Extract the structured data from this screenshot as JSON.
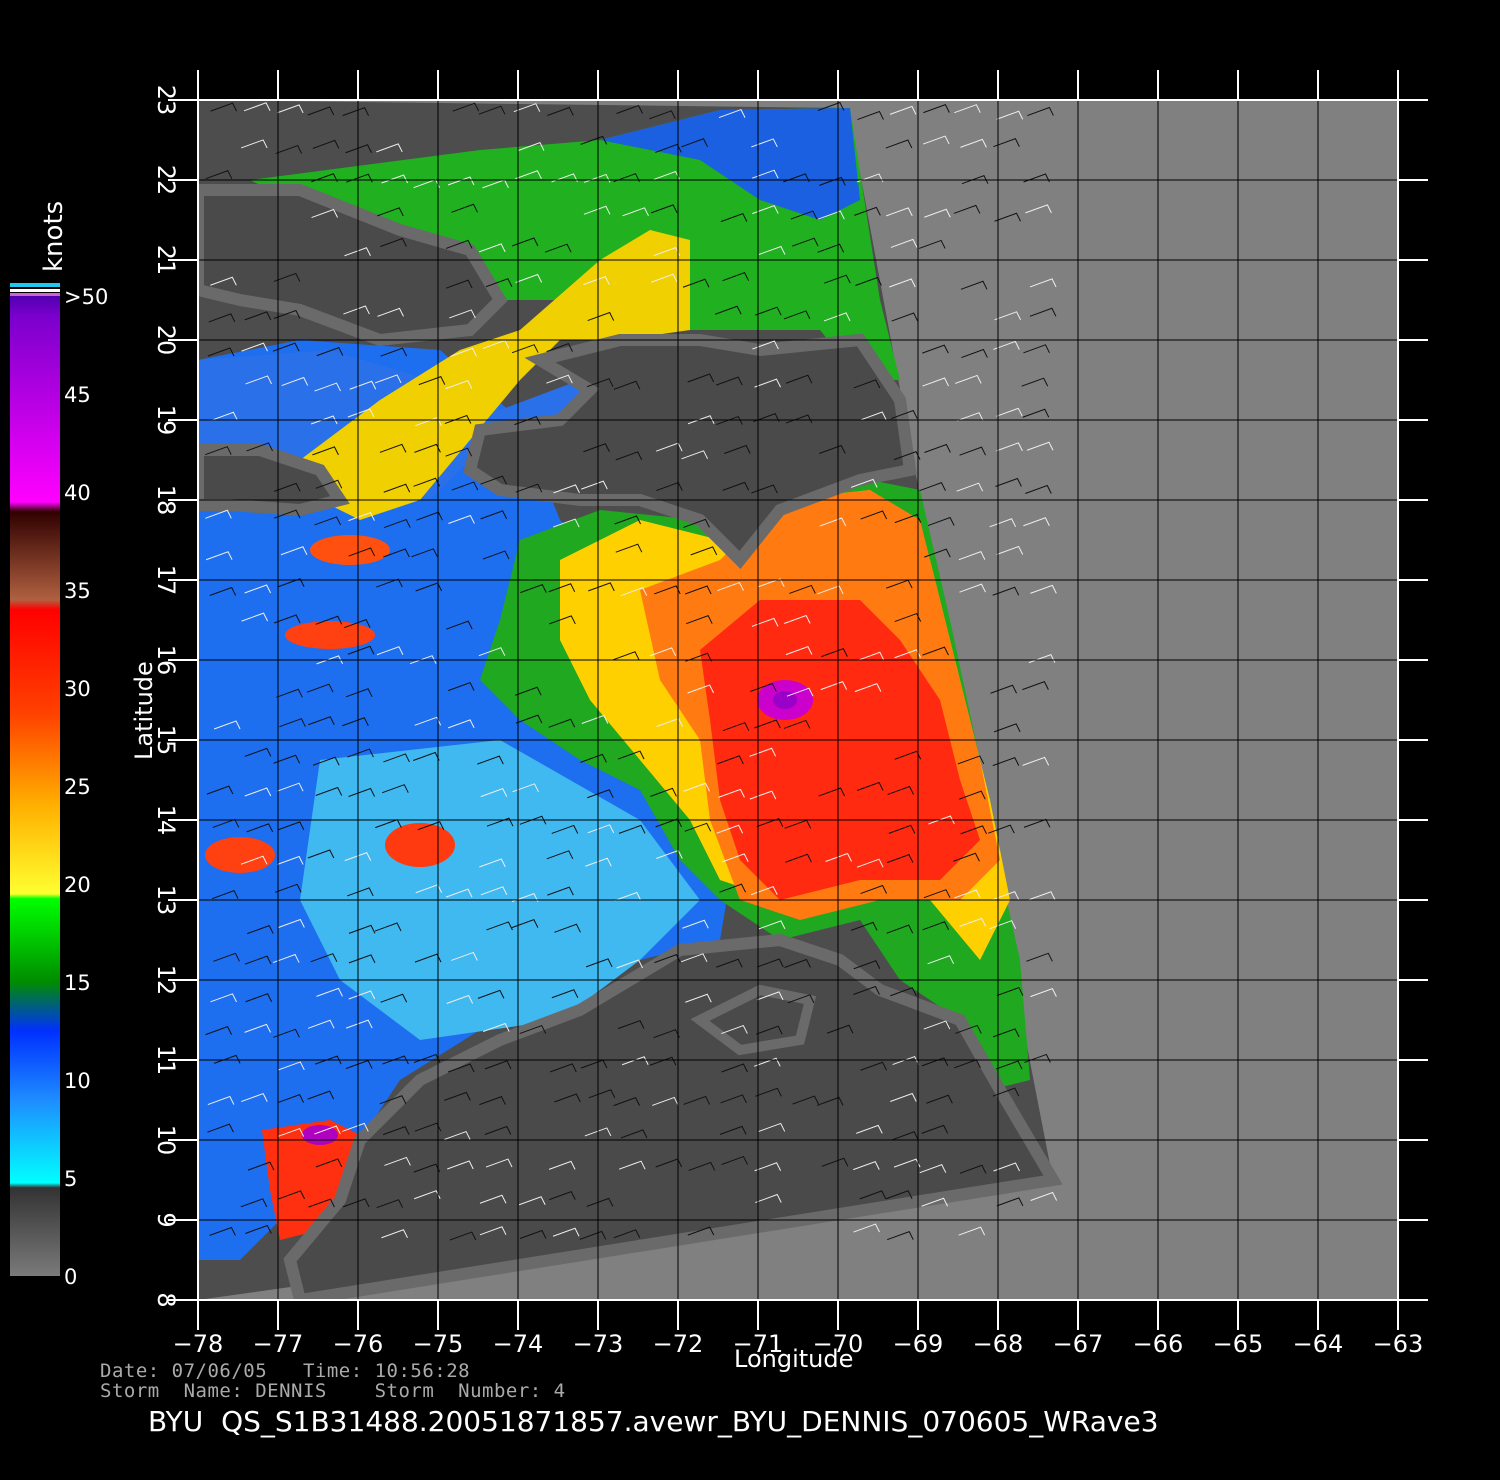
{
  "plot": {
    "x_axis_label": "Longitude",
    "y_axis_label": "Latitude",
    "lon_ticks": [
      "-78",
      "-77",
      "-76",
      "-75",
      "-74",
      "-73",
      "-72",
      "-71",
      "-70",
      "-69",
      "-68",
      "-67",
      "-66",
      "-65",
      "-64",
      "-63"
    ],
    "lat_ticks": [
      "8",
      "9",
      "10",
      "11",
      "12",
      "13",
      "14",
      "15",
      "16",
      "17",
      "18",
      "19",
      "20",
      "21",
      "22",
      "23"
    ],
    "lon_range": [
      -78,
      -63
    ],
    "lat_range": [
      8,
      23
    ],
    "grid": true,
    "storm_center": {
      "lon": -70.7,
      "lat": 15.5
    }
  },
  "colorbar": {
    "unit_label": "knots",
    "labels": [
      "0",
      "5",
      "10",
      "15",
      "20",
      "25",
      "30",
      "35",
      "40",
      "45",
      ">50"
    ],
    "colors": {
      "0-5": "#555555",
      "5-10": "#20c8f0",
      "10-15": "#1e6ef0",
      "15-20": "#10b010",
      "20-25": "#ffd000",
      "25-30": "#ff8000",
      "30-35": "#ff2010",
      "35-40": "#8a4a30",
      "40-45": "#ff00ff",
      "45-50": "#9a00c8"
    }
  },
  "colors": {
    "background": "#000000",
    "land": "#4a4a4a",
    "swath_nodata": "#808080",
    "coast_fringe": "#6a6a6a"
  },
  "info": {
    "date_line": "Date: 07/06/05   Time: 10:56:28",
    "storm_line": "Storm  Name: DENNIS    Storm  Number: 4",
    "file_title": "BYU  QS_S1B31488.20051871857.avewr_BYU_DENNIS_070605_WRave3"
  }
}
